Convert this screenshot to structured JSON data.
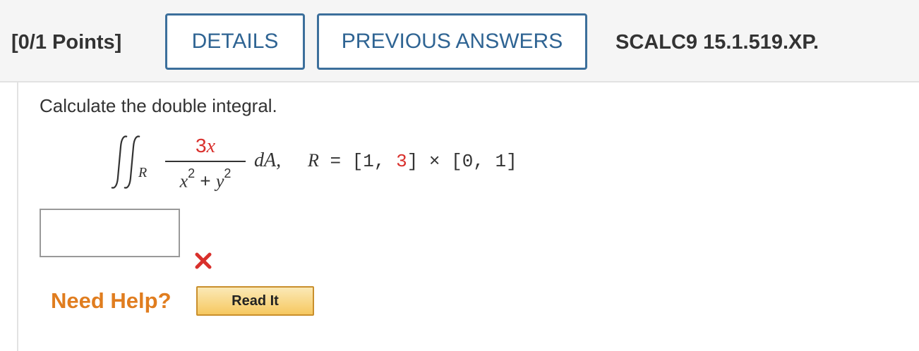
{
  "header": {
    "points": "[0/1 Points]",
    "details_label": "DETAILS",
    "previous_answers_label": "PREVIOUS ANSWERS",
    "problem_code": "SCALC9 15.1.519.XP."
  },
  "question": {
    "prompt": "Calculate the double integral.",
    "integral_subscript": "R",
    "numerator_coef": "3",
    "numerator_var": "x",
    "den_x": "x",
    "den_x_exp": "2",
    "den_plus": " + ",
    "den_y": "y",
    "den_y_exp": "2",
    "differential": "dA,",
    "region_var": "R",
    "region_eq": " = [1, ",
    "region_red": "3",
    "region_rest": "] × [0, 1]"
  },
  "answer": {
    "value": "",
    "status_icon": "wrong-x-icon"
  },
  "help": {
    "need_help_label": "Need Help?",
    "read_it_label": "Read It"
  },
  "colors": {
    "accent_blue": "#2f6493",
    "wrong_red": "#d9302c",
    "help_orange": "#e07d1f"
  }
}
